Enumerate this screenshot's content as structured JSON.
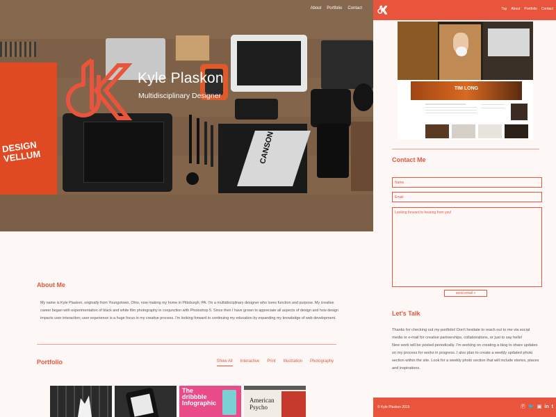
{
  "left": {
    "nav": [
      "About",
      "Portfolio",
      "Contact"
    ],
    "hero": {
      "name": "Kyle Plaskon",
      "subtitle": "Multidisciplinary Designer",
      "book_title": "DESIGN VELLUM",
      "sketch_book": "CANSON"
    },
    "about": {
      "title": "About Me",
      "text": "My name is Kyle Plaskon, originally from Youngstown, Ohio, now making my home in Pittsburgh, PA. I'm a multidisciplinary designer who loves function and purpose. My creative career began with experimentation of black and white film photography in conjunction with Photoshop 5. Since then I have grown to appreciate all aspects of design and how design impacts user interaction; user experience is a huge focus in my creative process. I'm looking forward to continuing my education by expanding my knowledge of web development."
    },
    "portfolio": {
      "title": "Portfolio",
      "filters": [
        "Show All",
        "Interactive",
        "Print",
        "Illustration",
        "Photography"
      ],
      "thumbs": [
        {
          "label": ""
        },
        {
          "label": ""
        },
        {
          "label": "The dribbble Infographic"
        },
        {
          "label": "American Psycho"
        }
      ]
    }
  },
  "right": {
    "nav": [
      "Top",
      "About",
      "Portfolio",
      "Contact"
    ],
    "preview_banner": "TIM LONG",
    "contact": {
      "title": "Contact Me",
      "name_placeholder": "Name",
      "email_placeholder": "Email",
      "message_placeholder": "Looking forward to hearing from you!",
      "send_label": "send email »"
    },
    "talk": {
      "title": "Let's Talk",
      "para1": "Thanks for checking out my portfolio! Don't hesitate to reach out to me via social media or e-mail for creative partnerships, collaborations, or just to say hello!",
      "para2": "New work will be posted periodically. I'm working on creating a blog to share updates on my process for works in progress. I also plan to create a weekly updated photo section within the site. Look for a weekly photo section that will include stories, places and inspirations."
    },
    "footer": {
      "copyright": "© Kyle Plaskon 2015",
      "social_icons": [
        "pinterest-icon",
        "twitter-icon",
        "instagram-icon",
        "linkedin-icon",
        "tumblr-icon"
      ]
    }
  },
  "colors": {
    "accent": "#e8553c",
    "background": "#fdf7f6"
  }
}
